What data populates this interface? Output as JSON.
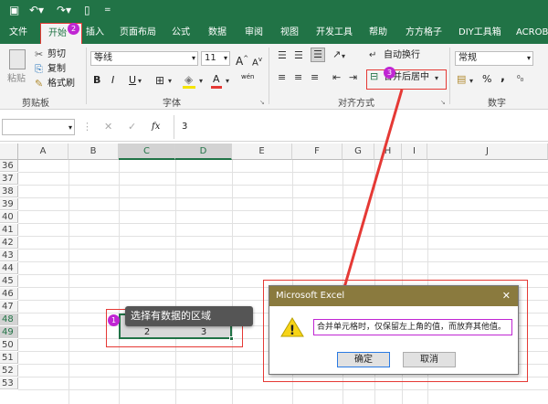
{
  "quick_access": {
    "save_icon": "save-icon",
    "undo_icon": "undo-icon",
    "redo_icon": "redo-icon",
    "preview_icon": "print-preview-icon",
    "more_icon": "customize-icon"
  },
  "tabs": [
    {
      "label": "文件"
    },
    {
      "label": "开始"
    },
    {
      "label": "插入"
    },
    {
      "label": "页面布局"
    },
    {
      "label": "公式"
    },
    {
      "label": "数据"
    },
    {
      "label": "审阅"
    },
    {
      "label": "视图"
    },
    {
      "label": "开发工具"
    },
    {
      "label": "帮助"
    },
    {
      "label": "方方格子"
    },
    {
      "label": "DIY工具箱"
    },
    {
      "label": "ACROBA"
    }
  ],
  "ribbon": {
    "paste": "粘贴",
    "cut": "剪切",
    "copy": "复制",
    "format_painter": "格式刷",
    "clipboard_group": "剪贴板",
    "font_name": "等线",
    "font_size": "11",
    "grow_font": "A",
    "shrink_font": "A",
    "bold": "B",
    "italic": "I",
    "underline": "U",
    "font_color_glyph": "A",
    "wen_glyph": "wén",
    "font_group": "字体",
    "wrap_text": "自动换行",
    "merge_center": "合并后居中",
    "alignment_group": "对齐方式",
    "number_format": "常规",
    "percent": "%",
    "comma": ",",
    "number_group": "数字"
  },
  "formula_bar": {
    "name_box": "",
    "fx": "fx",
    "value": "3"
  },
  "columns": [
    "A",
    "B",
    "C",
    "D",
    "E",
    "F",
    "G",
    "H",
    "I",
    "J"
  ],
  "rows": [
    "36",
    "37",
    "38",
    "39",
    "40",
    "41",
    "42",
    "43",
    "44",
    "45",
    "46",
    "47",
    "48",
    "49",
    "50",
    "51",
    "52",
    "53"
  ],
  "cells": {
    "c49": "2",
    "d49": "3"
  },
  "annotations": {
    "callout_1": "选择有数据的区域",
    "badge_1": "1",
    "badge_2": "2",
    "badge_3": "3"
  },
  "dialog": {
    "title": "Microsoft Excel",
    "message": "合并单元格时，仅保留左上角的值，而放弃其他值。",
    "ok": "确定",
    "cancel": "取消",
    "close": "✕",
    "warning": "!"
  },
  "colors": {
    "accent": "#217346",
    "annotation": "#e53935",
    "badge": "#c026d3",
    "dialog_title": "#8a7a3e"
  }
}
